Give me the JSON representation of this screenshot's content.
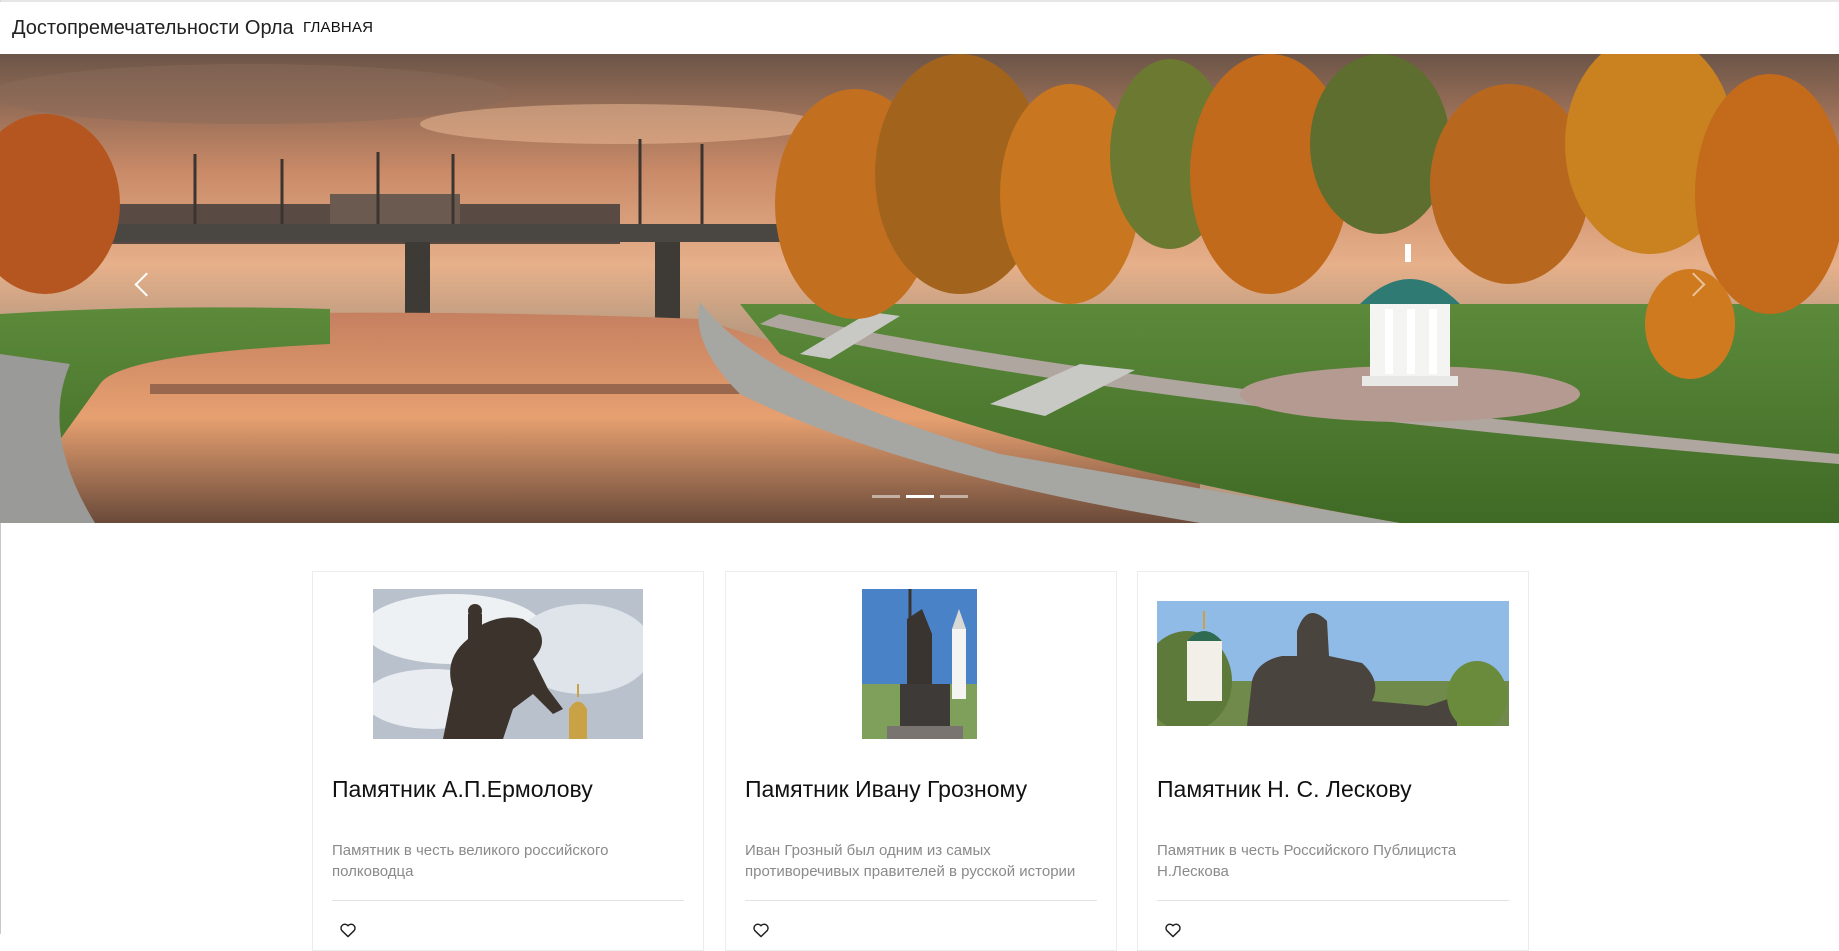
{
  "navbar": {
    "brand": "Достопремечательности Орла",
    "links": [
      {
        "label": "ГЛАВНАЯ"
      }
    ]
  },
  "hero": {
    "prev_icon": "chevron-left-icon",
    "next_icon": "chevron-right-icon",
    "slide_count": 3,
    "active_slide": 2
  },
  "cards": [
    {
      "title": "Памятник А.П.Ермолову",
      "text": "Памятник в честь великого российского полководца",
      "icon": "heart-icon"
    },
    {
      "title": "Памятник Ивану Грозному",
      "text": "Иван Грозный был одним из самых противоречивых правителей в русской истории",
      "icon": "heart-icon"
    },
    {
      "title": "Памятник Н. С. Лескову",
      "text": "Памятник в честь Российского Публициста Н.Лескова",
      "icon": "heart-icon"
    }
  ]
}
